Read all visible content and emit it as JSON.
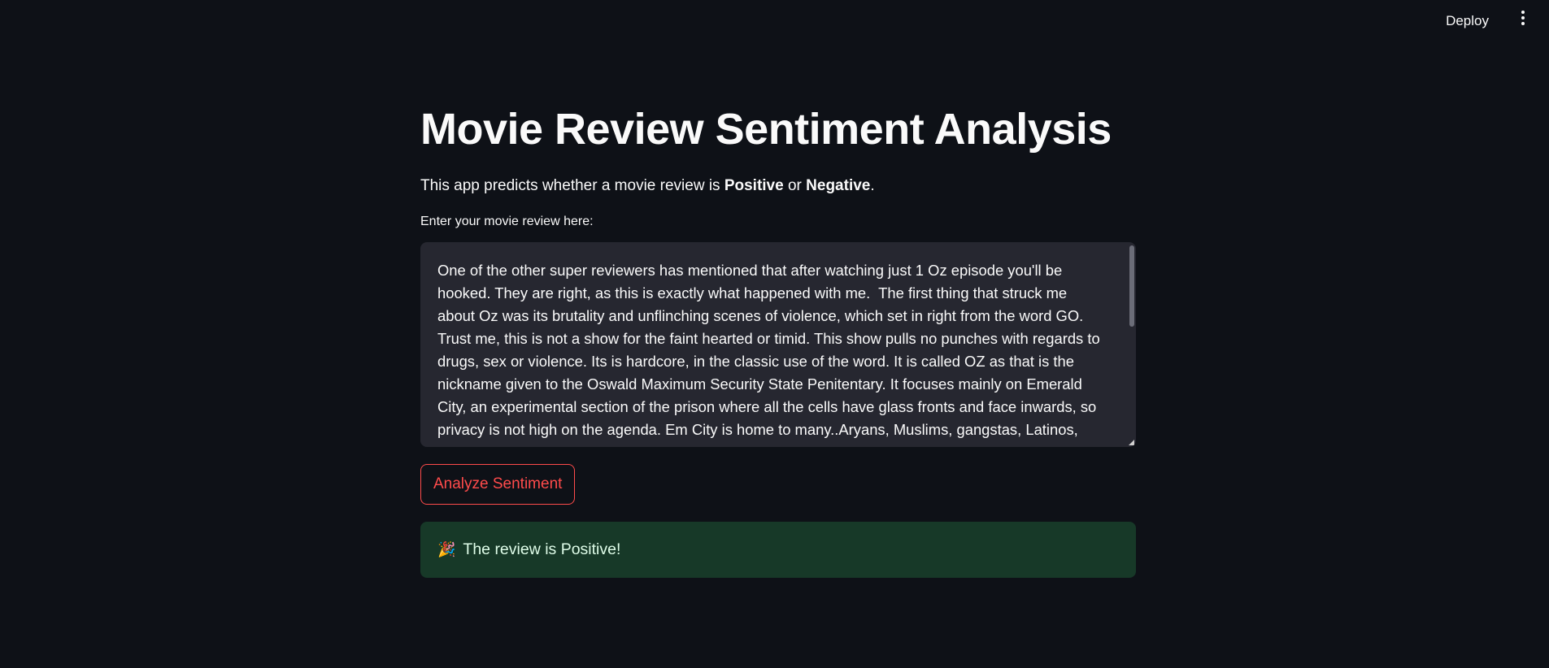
{
  "header": {
    "deploy_label": "Deploy",
    "menu_icon": "vertical-dots-icon"
  },
  "main": {
    "title": "Movie Review Sentiment Analysis",
    "subtitle_prefix": "This app predicts whether a movie review is ",
    "subtitle_positive": "Positive",
    "subtitle_or": " or ",
    "subtitle_negative": "Negative",
    "subtitle_suffix": ".",
    "input_label": "Enter your movie review here:",
    "review_text": "One of the other super reviewers has mentioned that after watching just 1 Oz episode you'll be hooked. They are right, as this is exactly what happened with me.  The first thing that struck me about Oz was its brutality and unflinching scenes of violence, which set in right from the word GO. Trust me, this is not a show for the faint hearted or timid. This show pulls no punches with regards to drugs, sex or violence. Its is hardcore, in the classic use of the word. It is called OZ as that is the nickname given to the Oswald Maximum Security State Penitentary. It focuses mainly on Emerald City, an experimental section of the prison where all the cells have glass fronts and face inwards, so privacy is not high on the agenda. Em City is home to many..Aryans, Muslims, gangstas, Latinos,",
    "analyze_button": "Analyze Sentiment",
    "result_icon": "🎉",
    "result_text": "The review is Positive!"
  },
  "colors": {
    "background": "#0e1117",
    "accent": "#ff4b4b",
    "success_bg": "#173928",
    "input_bg": "#262730"
  }
}
